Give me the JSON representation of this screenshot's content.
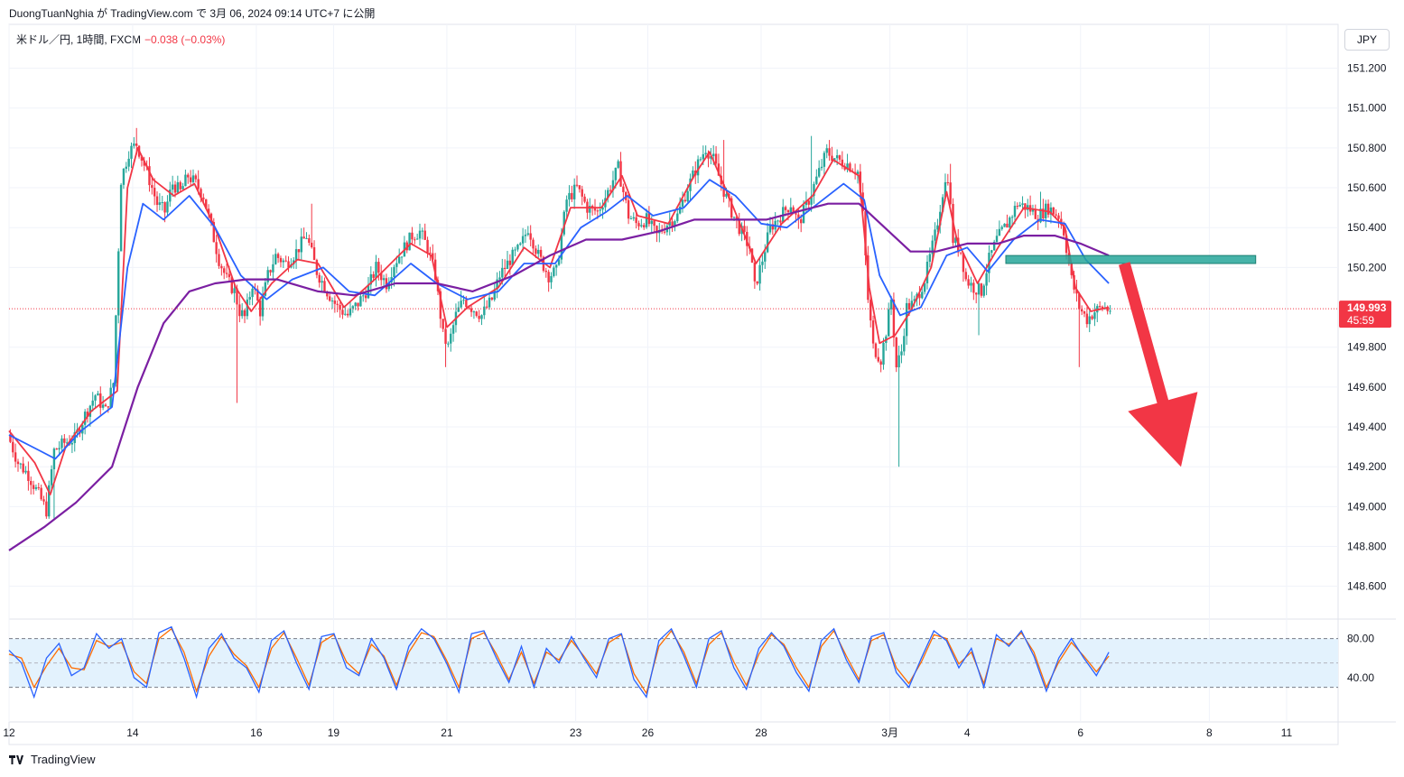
{
  "publish_line": "DuongTuanNghia が TradingView.com で 3月 06, 2024 09:14 UTC+7 に公開",
  "legend": {
    "symbol": "米ドル／円, 1時間, FXCM",
    "change": "−0.038 (−0.03%)"
  },
  "unit_button": "JPY",
  "brand": "TradingView",
  "colors": {
    "up": "#26a69a",
    "down": "#f23645",
    "ema_fast": "#f23645",
    "ema_mid": "#2962ff",
    "ema_slow": "#7b1fa2",
    "zone": "#26a69a",
    "arrow": "#f23645",
    "stoch_k": "#2962ff",
    "stoch_d": "#ff6d00",
    "stoch_band": "#e3f2fd"
  },
  "chart_data": {
    "type": "candlestick",
    "symbol": "米ドル／円",
    "timeframe": "1時間",
    "source": "FXCM",
    "last_price": "149.993",
    "countdown": "45:59",
    "y_ticks": [
      "151.200",
      "151.000",
      "150.800",
      "150.600",
      "150.400",
      "150.200",
      "149.800",
      "149.600",
      "149.400",
      "149.200",
      "149.000",
      "148.800",
      "148.600"
    ],
    "ylim": [
      148.44,
      151.42
    ],
    "x_ticks": [
      {
        "label": "12",
        "t": 0
      },
      {
        "label": "14",
        "t": 48
      },
      {
        "label": "16",
        "t": 96
      },
      {
        "label": "19",
        "t": 126
      },
      {
        "label": "21",
        "t": 170
      },
      {
        "label": "23",
        "t": 220
      },
      {
        "label": "26",
        "t": 248
      },
      {
        "label": "28",
        "t": 292
      },
      {
        "label": "3月",
        "t": 342
      },
      {
        "label": "4",
        "t": 372
      },
      {
        "label": "6",
        "t": 416
      },
      {
        "label": "8",
        "t": 466
      },
      {
        "label": "11",
        "t": 496
      }
    ],
    "price_path": [
      [
        0,
        149.36
      ],
      [
        4,
        149.22
      ],
      [
        8,
        149.16
      ],
      [
        12,
        149.06
      ],
      [
        15,
        148.98
      ],
      [
        18,
        149.28
      ],
      [
        22,
        149.32
      ],
      [
        26,
        149.34
      ],
      [
        30,
        149.46
      ],
      [
        34,
        149.56
      ],
      [
        38,
        149.48
      ],
      [
        41,
        149.62
      ],
      [
        44,
        150.64
      ],
      [
        47,
        150.78
      ],
      [
        50,
        150.82
      ],
      [
        54,
        150.68
      ],
      [
        58,
        150.52
      ],
      [
        61,
        150.48
      ],
      [
        64,
        150.62
      ],
      [
        67,
        150.58
      ],
      [
        70,
        150.66
      ],
      [
        73,
        150.62
      ],
      [
        76,
        150.56
      ],
      [
        79,
        150.4
      ],
      [
        82,
        150.24
      ],
      [
        85,
        150.14
      ],
      [
        88,
        150.08
      ],
      [
        90,
        149.98
      ],
      [
        92,
        149.95
      ],
      [
        95,
        150.12
      ],
      [
        98,
        149.98
      ],
      [
        101,
        150.16
      ],
      [
        104,
        150.26
      ],
      [
        108,
        150.22
      ],
      [
        112,
        150.28
      ],
      [
        116,
        150.36
      ],
      [
        120,
        150.18
      ],
      [
        124,
        150.08
      ],
      [
        128,
        150.0
      ],
      [
        132,
        149.96
      ],
      [
        136,
        150.02
      ],
      [
        140,
        150.1
      ],
      [
        143,
        150.2
      ],
      [
        147,
        150.12
      ],
      [
        150,
        150.22
      ],
      [
        153,
        150.28
      ],
      [
        157,
        150.36
      ],
      [
        160,
        150.38
      ],
      [
        163,
        150.3
      ],
      [
        166,
        150.16
      ],
      [
        169,
        149.86
      ],
      [
        171,
        149.8
      ],
      [
        174,
        149.96
      ],
      [
        177,
        150.04
      ],
      [
        180,
        150.0
      ],
      [
        184,
        149.96
      ],
      [
        188,
        150.04
      ],
      [
        191,
        150.16
      ],
      [
        195,
        150.24
      ],
      [
        199,
        150.3
      ],
      [
        202,
        150.4
      ],
      [
        206,
        150.26
      ],
      [
        210,
        150.16
      ],
      [
        213,
        150.18
      ],
      [
        217,
        150.54
      ],
      [
        221,
        150.6
      ],
      [
        225,
        150.5
      ],
      [
        229,
        150.48
      ],
      [
        233,
        150.58
      ],
      [
        237,
        150.7
      ],
      [
        241,
        150.46
      ],
      [
        244,
        150.42
      ],
      [
        248,
        150.44
      ],
      [
        252,
        150.36
      ],
      [
        256,
        150.42
      ],
      [
        260,
        150.46
      ],
      [
        264,
        150.6
      ],
      [
        268,
        150.72
      ],
      [
        271,
        150.8
      ],
      [
        274,
        150.74
      ],
      [
        277,
        150.62
      ],
      [
        281,
        150.48
      ],
      [
        284,
        150.4
      ],
      [
        288,
        150.3
      ],
      [
        290,
        150.1
      ],
      [
        293,
        150.24
      ],
      [
        296,
        150.4
      ],
      [
        300,
        150.46
      ],
      [
        304,
        150.52
      ],
      [
        307,
        150.42
      ],
      [
        311,
        150.54
      ],
      [
        315,
        150.68
      ],
      [
        318,
        150.78
      ],
      [
        322,
        150.74
      ],
      [
        326,
        150.72
      ],
      [
        330,
        150.68
      ],
      [
        332,
        150.46
      ],
      [
        334,
        150.04
      ],
      [
        336,
        149.8
      ],
      [
        339,
        149.74
      ],
      [
        341,
        149.88
      ],
      [
        343,
        150.04
      ],
      [
        345,
        149.7
      ],
      [
        347,
        149.78
      ],
      [
        349,
        150.0
      ],
      [
        352,
        150.02
      ],
      [
        356,
        150.14
      ],
      [
        360,
        150.36
      ],
      [
        363,
        150.58
      ],
      [
        365,
        150.66
      ],
      [
        367,
        150.34
      ],
      [
        370,
        150.28
      ],
      [
        372,
        150.14
      ],
      [
        375,
        150.1
      ],
      [
        378,
        150.08
      ],
      [
        381,
        150.24
      ],
      [
        384,
        150.34
      ],
      [
        388,
        150.42
      ],
      [
        392,
        150.52
      ],
      [
        396,
        150.5
      ],
      [
        400,
        150.46
      ],
      [
        404,
        150.5
      ],
      [
        408,
        150.46
      ],
      [
        410,
        150.38
      ],
      [
        413,
        150.14
      ],
      [
        416,
        150.0
      ],
      [
        419,
        149.94
      ],
      [
        422,
        149.98
      ],
      [
        425,
        150.0
      ],
      [
        427,
        149.99
      ]
    ],
    "lows": [
      [
        17,
        148.94
      ],
      [
        88,
        149.52
      ],
      [
        169,
        149.7
      ],
      [
        345,
        149.2
      ],
      [
        345,
        149.46
      ],
      [
        376,
        149.86
      ],
      [
        415,
        149.7
      ]
    ],
    "highs": [
      [
        49,
        150.9
      ],
      [
        117,
        150.52
      ],
      [
        237,
        150.78
      ],
      [
        277,
        150.84
      ],
      [
        311,
        150.86
      ],
      [
        365,
        150.72
      ],
      [
        400,
        150.58
      ]
    ],
    "moving_averages": [
      {
        "name": "",
        "color": "#f23645",
        "points": [
          [
            0,
            149.38
          ],
          [
            10,
            149.22
          ],
          [
            16,
            149.06
          ],
          [
            22,
            149.3
          ],
          [
            32,
            149.48
          ],
          [
            42,
            149.58
          ],
          [
            46,
            150.6
          ],
          [
            50,
            150.8
          ],
          [
            56,
            150.64
          ],
          [
            64,
            150.56
          ],
          [
            72,
            150.62
          ],
          [
            80,
            150.4
          ],
          [
            88,
            150.1
          ],
          [
            94,
            149.98
          ],
          [
            102,
            150.12
          ],
          [
            112,
            150.24
          ],
          [
            120,
            150.22
          ],
          [
            130,
            150.0
          ],
          [
            142,
            150.14
          ],
          [
            156,
            150.32
          ],
          [
            164,
            150.26
          ],
          [
            170,
            149.9
          ],
          [
            178,
            150.0
          ],
          [
            190,
            150.1
          ],
          [
            200,
            150.3
          ],
          [
            210,
            150.2
          ],
          [
            218,
            150.5
          ],
          [
            230,
            150.5
          ],
          [
            238,
            150.66
          ],
          [
            244,
            150.46
          ],
          [
            256,
            150.42
          ],
          [
            266,
            150.66
          ],
          [
            272,
            150.78
          ],
          [
            280,
            150.54
          ],
          [
            290,
            150.22
          ],
          [
            300,
            150.42
          ],
          [
            312,
            150.56
          ],
          [
            320,
            150.74
          ],
          [
            330,
            150.66
          ],
          [
            334,
            150.1
          ],
          [
            338,
            149.82
          ],
          [
            344,
            149.86
          ],
          [
            350,
            149.98
          ],
          [
            358,
            150.2
          ],
          [
            364,
            150.58
          ],
          [
            368,
            150.34
          ],
          [
            376,
            150.12
          ],
          [
            384,
            150.3
          ],
          [
            394,
            150.5
          ],
          [
            404,
            150.48
          ],
          [
            410,
            150.4
          ],
          [
            414,
            150.1
          ],
          [
            420,
            149.98
          ],
          [
            427,
            150.0
          ]
        ]
      },
      {
        "name": "",
        "color": "#2962ff",
        "points": [
          [
            0,
            149.36
          ],
          [
            12,
            149.28
          ],
          [
            18,
            149.24
          ],
          [
            28,
            149.38
          ],
          [
            40,
            149.5
          ],
          [
            46,
            150.2
          ],
          [
            52,
            150.52
          ],
          [
            60,
            150.44
          ],
          [
            70,
            150.56
          ],
          [
            80,
            150.4
          ],
          [
            90,
            150.16
          ],
          [
            100,
            150.04
          ],
          [
            110,
            150.14
          ],
          [
            122,
            150.2
          ],
          [
            132,
            150.08
          ],
          [
            142,
            150.06
          ],
          [
            156,
            150.22
          ],
          [
            166,
            150.12
          ],
          [
            178,
            150.04
          ],
          [
            190,
            150.08
          ],
          [
            200,
            150.22
          ],
          [
            212,
            150.22
          ],
          [
            222,
            150.4
          ],
          [
            232,
            150.48
          ],
          [
            240,
            150.56
          ],
          [
            250,
            150.46
          ],
          [
            262,
            150.5
          ],
          [
            272,
            150.64
          ],
          [
            282,
            150.56
          ],
          [
            292,
            150.42
          ],
          [
            302,
            150.4
          ],
          [
            314,
            150.52
          ],
          [
            324,
            150.62
          ],
          [
            332,
            150.54
          ],
          [
            338,
            150.16
          ],
          [
            346,
            149.96
          ],
          [
            354,
            150.0
          ],
          [
            364,
            150.26
          ],
          [
            372,
            150.3
          ],
          [
            380,
            150.18
          ],
          [
            390,
            150.34
          ],
          [
            400,
            150.44
          ],
          [
            410,
            150.42
          ],
          [
            418,
            150.24
          ],
          [
            427,
            150.12
          ]
        ]
      },
      {
        "name": "",
        "color": "#7b1fa2",
        "points": [
          [
            0,
            148.78
          ],
          [
            14,
            148.9
          ],
          [
            26,
            149.02
          ],
          [
            40,
            149.2
          ],
          [
            50,
            149.6
          ],
          [
            60,
            149.92
          ],
          [
            70,
            150.08
          ],
          [
            80,
            150.12
          ],
          [
            92,
            150.14
          ],
          [
            104,
            150.14
          ],
          [
            120,
            150.08
          ],
          [
            134,
            150.06
          ],
          [
            150,
            150.12
          ],
          [
            166,
            150.12
          ],
          [
            180,
            150.08
          ],
          [
            196,
            150.16
          ],
          [
            210,
            150.26
          ],
          [
            224,
            150.34
          ],
          [
            238,
            150.34
          ],
          [
            252,
            150.38
          ],
          [
            266,
            150.44
          ],
          [
            280,
            150.44
          ],
          [
            294,
            150.44
          ],
          [
            306,
            150.48
          ],
          [
            318,
            150.52
          ],
          [
            330,
            150.52
          ],
          [
            340,
            150.4
          ],
          [
            350,
            150.28
          ],
          [
            360,
            150.28
          ],
          [
            372,
            150.32
          ],
          [
            384,
            150.32
          ],
          [
            394,
            150.36
          ],
          [
            406,
            150.36
          ],
          [
            416,
            150.32
          ],
          [
            427,
            150.26
          ]
        ]
      }
    ],
    "zone": {
      "t0": 387,
      "t1": 484,
      "y0": 150.22,
      "y1": 150.26
    },
    "projection_arrow": {
      "from": [
        433,
        150.22
      ],
      "to": [
        455,
        149.2
      ]
    },
    "stochastic": {
      "levels": [
        "80.00",
        "40.00"
      ],
      "band": [
        30,
        80
      ],
      "k": [
        68,
        55,
        20,
        60,
        75,
        42,
        50,
        85,
        70,
        80,
        40,
        30,
        86,
        92,
        60,
        20,
        70,
        85,
        60,
        50,
        25,
        78,
        88,
        55,
        28,
        82,
        85,
        50,
        42,
        80,
        60,
        28,
        72,
        90,
        80,
        55,
        25,
        85,
        88,
        60,
        35,
        72,
        30,
        70,
        55,
        82,
        60,
        40,
        80,
        85,
        38,
        20,
        78,
        90,
        62,
        30,
        80,
        88,
        50,
        28,
        70,
        86,
        72,
        45,
        26,
        78,
        90,
        58,
        35,
        82,
        86,
        45,
        30,
        60,
        88,
        78,
        50,
        70,
        30,
        84,
        72,
        88,
        62,
        26,
        60,
        80,
        60,
        42,
        66
      ],
      "d": [
        64,
        60,
        30,
        52,
        70,
        50,
        48,
        78,
        72,
        76,
        46,
        34,
        80,
        90,
        66,
        26,
        62,
        82,
        64,
        52,
        30,
        70,
        86,
        60,
        32,
        76,
        84,
        56,
        44,
        74,
        62,
        32,
        66,
        86,
        82,
        58,
        30,
        80,
        86,
        64,
        38,
        66,
        34,
        66,
        58,
        78,
        62,
        44,
        76,
        84,
        44,
        24,
        72,
        88,
        66,
        34,
        74,
        86,
        56,
        32,
        64,
        84,
        74,
        50,
        30,
        72,
        88,
        62,
        38,
        78,
        84,
        50,
        34,
        56,
        84,
        80,
        54,
        66,
        34,
        80,
        74,
        86,
        66,
        30,
        56,
        76,
        62,
        46,
        62
      ]
    }
  }
}
